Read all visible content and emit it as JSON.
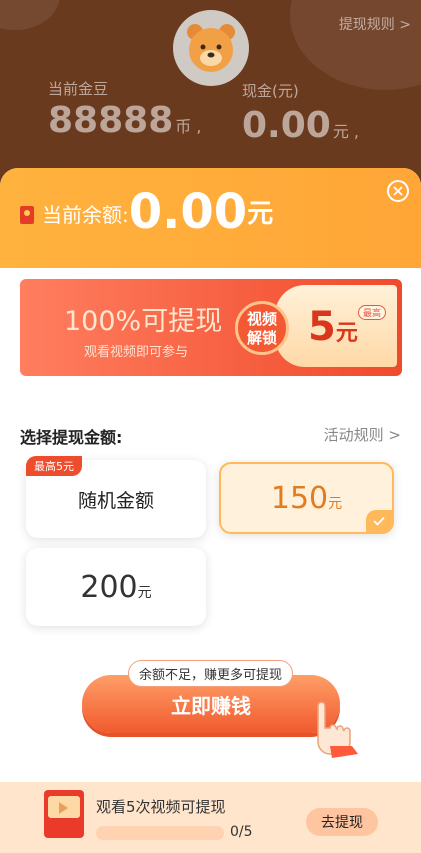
{
  "background": {
    "rules_link": "提现规则 >",
    "gold_label": "当前金豆",
    "gold_value": "88888",
    "gold_unit": "币 ,",
    "cash_label": "现金(元)",
    "cash_value": "0.00",
    "cash_unit": "元 ,"
  },
  "sheet": {
    "balance_label": "当前余额:",
    "balance_value": "0.00",
    "balance_unit": "元",
    "banner": {
      "headline": "100%可提现",
      "subline": "观看视频即可参与",
      "unlock_line1": "视频",
      "unlock_line2": "解锁",
      "max_tag": "最高",
      "amount": "5",
      "amount_unit": "元"
    },
    "select_title": "选择提现金额:",
    "activity_rules": "活动规则  >",
    "options": [
      {
        "label": "随机金额",
        "tag": "最高5元"
      },
      {
        "amount": "150",
        "unit": "元",
        "selected": true
      },
      {
        "amount": "200",
        "unit": "元"
      }
    ],
    "earn_bubble": "余额不足，赚更多可提现",
    "earn_button": "立即赚钱",
    "footer": {
      "desc": "观看5次视频可提现",
      "progress": "0/5",
      "progress_fraction": 0,
      "button": "去提现"
    }
  },
  "colors": {
    "orange": "#ffa637",
    "red": "#f04a2c",
    "selected_border": "#ffb85a"
  }
}
